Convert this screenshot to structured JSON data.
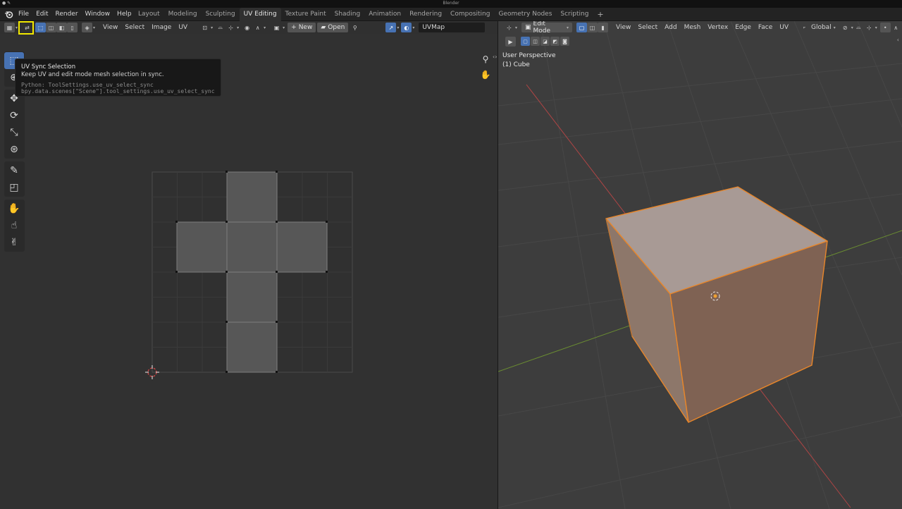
{
  "window": {
    "title": "Blender"
  },
  "menubar": {
    "items": [
      "File",
      "Edit",
      "Render",
      "Window",
      "Help"
    ]
  },
  "workspaces": {
    "tabs": [
      "Layout",
      "Modeling",
      "Sculpting",
      "UV Editing",
      "Texture Paint",
      "Shading",
      "Animation",
      "Rendering",
      "Compositing",
      "Geometry Nodes",
      "Scripting"
    ],
    "active": "UV Editing",
    "add_symbol": "+"
  },
  "uv_editor": {
    "menus": [
      "View",
      "Select",
      "Image",
      "UV"
    ],
    "new_label": "New",
    "open_label": "Open",
    "uvmap_field": "UVMap",
    "tooltip": {
      "title": "UV Sync Selection",
      "description": "Keep UV and edit mode mesh selection in sync.",
      "python": "Python: ToolSettings.use_uv_select_sync",
      "path": "bpy.data.scenes[\"Scene\"].tool_settings.use_uv_select_sync"
    }
  },
  "viewport": {
    "mode": "Edit Mode",
    "menus": [
      "View",
      "Select",
      "Add",
      "Mesh",
      "Vertex",
      "Edge",
      "Face",
      "UV"
    ],
    "orientation": "Global",
    "view_name": "User Perspective",
    "object_label": "(1) Cube"
  },
  "colors": {
    "accent_blue": "#4772b3",
    "highlight_yellow": "#f2e800",
    "selection_orange": "#e8862a",
    "uv_face_fill": "#5a5a5a",
    "axis_red": "#b04545",
    "axis_green": "#6a8c32"
  },
  "icons": [
    "blender-logo-icon",
    "uv-sync-icon",
    "cursor-icon",
    "move-icon",
    "rotate-icon",
    "scale-icon",
    "transform-icon",
    "annotate-icon",
    "rip-icon",
    "grab-icon",
    "relax-icon",
    "pinch-icon",
    "zoom-icon",
    "hand-icon",
    "pin-icon",
    "origin-icon"
  ]
}
